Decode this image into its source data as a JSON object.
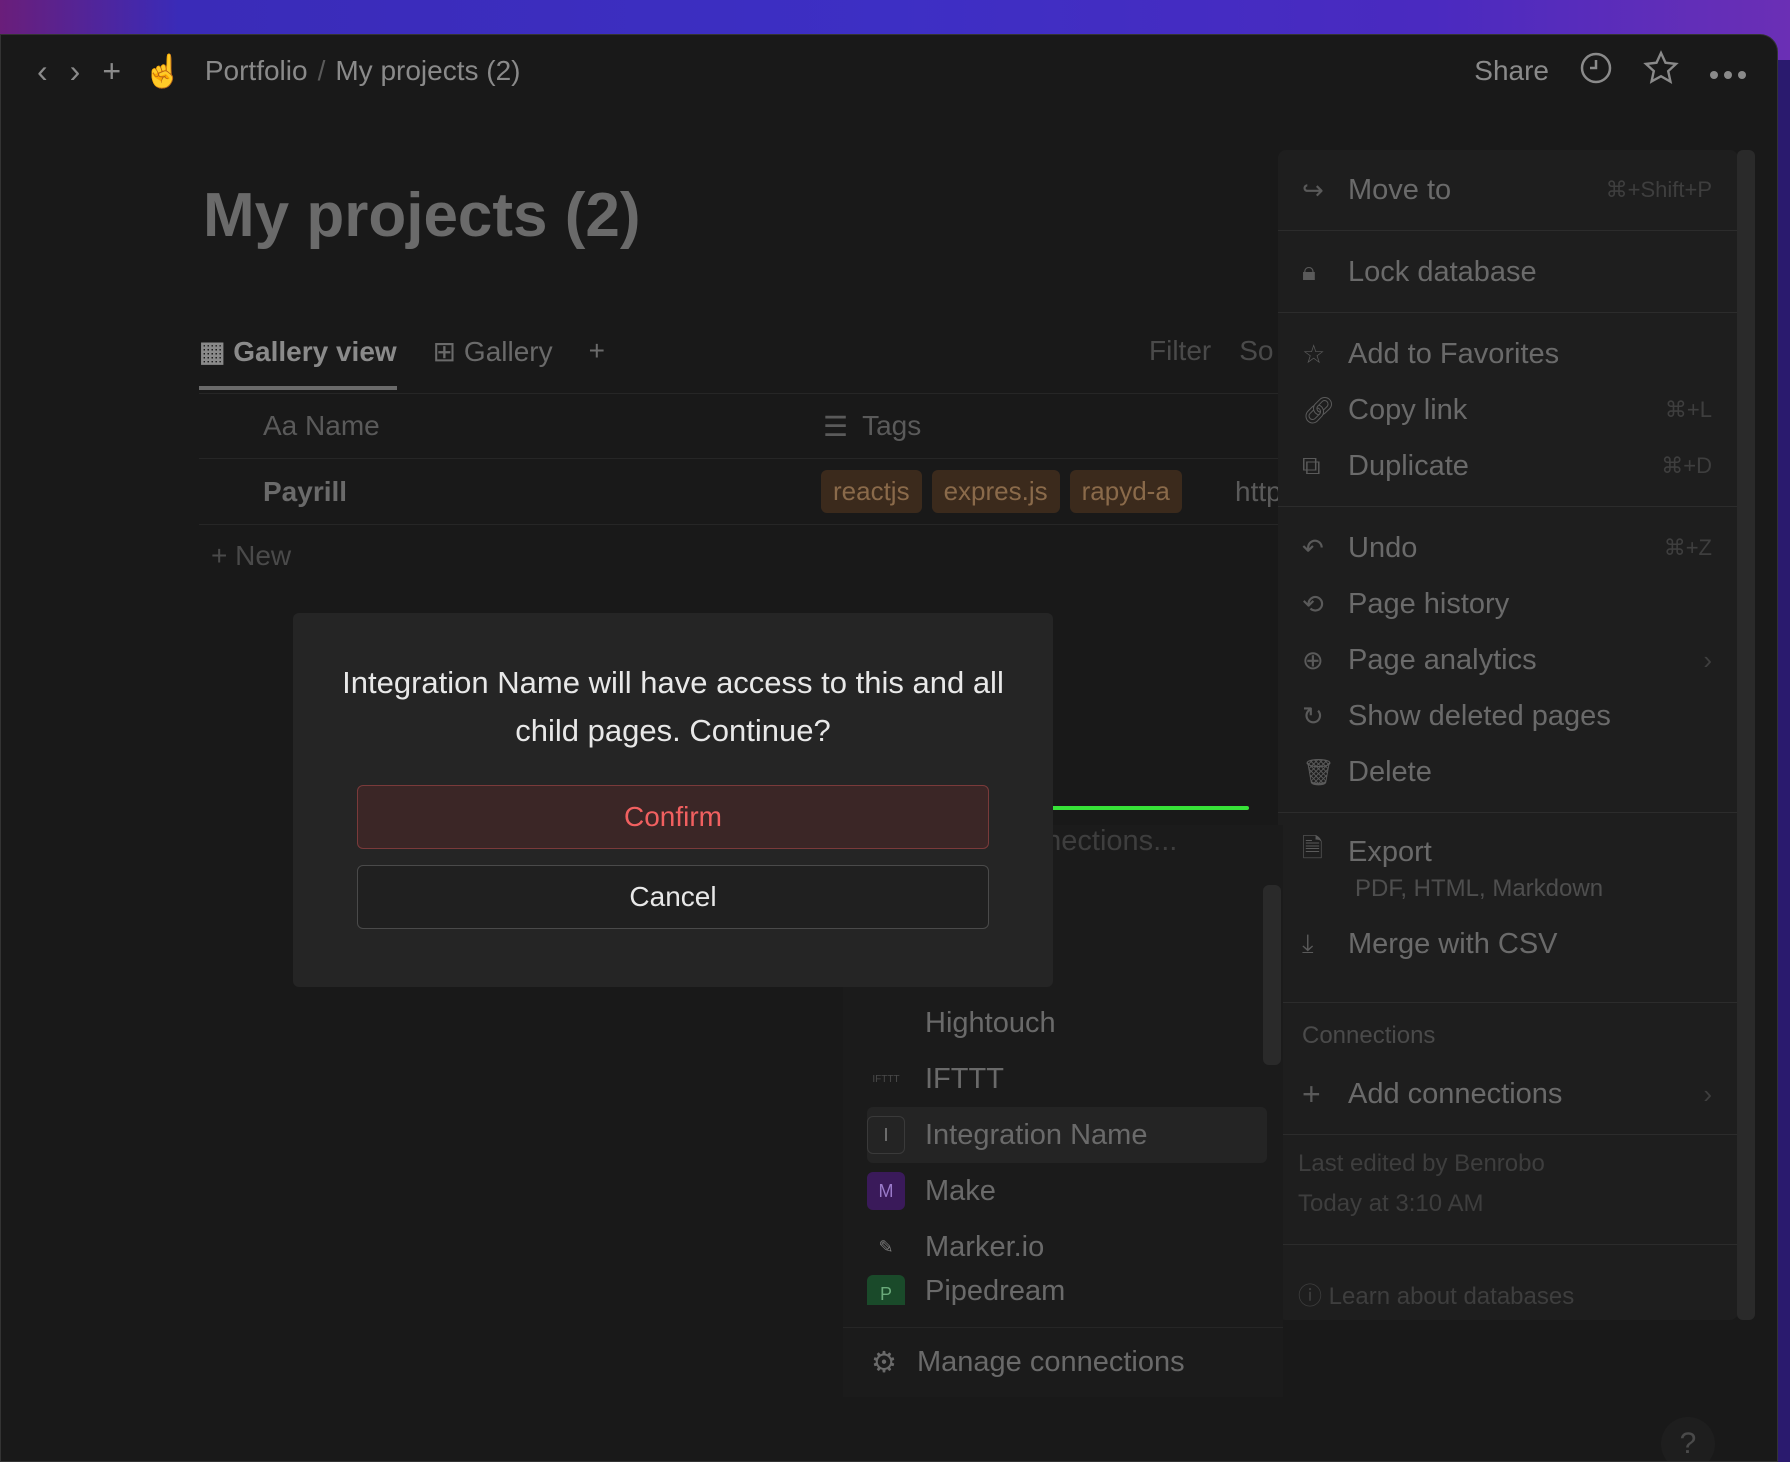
{
  "topbar": {
    "back": "‹",
    "forward": "›",
    "new": "+",
    "emoji": "☝",
    "crumb_root": "Portfolio",
    "crumb_sep": "/",
    "crumb_page": "My projects (2)",
    "share": "Share"
  },
  "page": {
    "title": "My projects (2)",
    "tabs": [
      "Gallery view",
      "Gallery"
    ],
    "tools": [
      "Filter",
      "So"
    ],
    "columns": [
      "Aa Name",
      "Tags"
    ],
    "row_name": "Payrill",
    "row_tags": [
      "reactjs",
      "expres.js",
      "rapyd-a"
    ],
    "row_link": "http",
    "new_label": "New"
  },
  "menu": {
    "move_to": "Move to",
    "move_to_sc": "⌘+Shift+P",
    "lock": "Lock database",
    "fav": "Add to Favorites",
    "copy_link": "Copy link",
    "copy_link_sc": "⌘+L",
    "duplicate": "Duplicate",
    "duplicate_sc": "⌘+D",
    "undo": "Undo",
    "undo_sc": "⌘+Z",
    "history": "Page history",
    "analytics": "Page analytics",
    "deleted": "Show deleted pages",
    "delete": "Delete",
    "export": "Export",
    "export_sub": "PDF, HTML, Markdown",
    "merge": "Merge with CSV",
    "connections_header": "Connections",
    "add_connections": "Add connections",
    "last_edited": "Last edited by Benrobo",
    "edited_time": "Today at 3:10 AM",
    "learn": "Learn about databases"
  },
  "connections": {
    "search_placeholder": "nnections...",
    "items": [
      "Hightouch",
      "IFTTT",
      "Integration Name",
      "Make",
      "Marker.io",
      "Pipedream"
    ],
    "manage": "Manage connections"
  },
  "modal": {
    "message": "Integration Name will have access to this and all child pages. Continue?",
    "confirm": "Confirm",
    "cancel": "Cancel"
  },
  "help": "?",
  "colors": {
    "annotation_arrow": "#37e238",
    "confirm_text": "#f16060"
  }
}
